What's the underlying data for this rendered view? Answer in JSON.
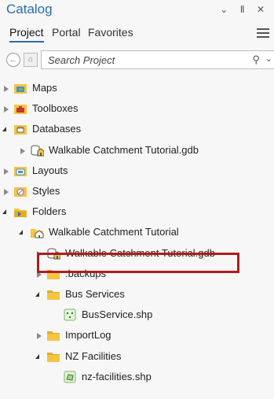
{
  "window": {
    "title": "Catalog",
    "controls": "⌄ ⊥ ✕"
  },
  "tabs": [
    "Project",
    "Portal",
    "Favorites"
  ],
  "search": {
    "placeholder": "Search Project"
  },
  "tree": [
    {
      "label": "Maps",
      "level": 0,
      "state": "closed",
      "icon": "maps-icon"
    },
    {
      "label": "Toolboxes",
      "level": 0,
      "state": "closed",
      "icon": "toolbox-icon"
    },
    {
      "label": "Databases",
      "level": 0,
      "state": "open",
      "icon": "database-folder-icon"
    },
    {
      "label": "Walkable Catchment Tutorial.gdb",
      "level": 1,
      "state": "closed",
      "icon": "geodatabase-icon"
    },
    {
      "label": "Layouts",
      "level": 0,
      "state": "closed",
      "icon": "layouts-icon"
    },
    {
      "label": "Styles",
      "level": 0,
      "state": "closed",
      "icon": "styles-icon"
    },
    {
      "label": "Folders",
      "level": 0,
      "state": "open",
      "icon": "folders-icon"
    },
    {
      "label": "Walkable Catchment Tutorial",
      "level": 1,
      "state": "open",
      "icon": "home-folder-icon"
    },
    {
      "label": "Walkable Catchment Tutorial.gdb",
      "level": 2,
      "state": "closed",
      "icon": "geodatabase-home-icon",
      "highlighted": true
    },
    {
      "label": ".backups",
      "level": 2,
      "state": "closed",
      "icon": "folder-icon"
    },
    {
      "label": "Bus Services",
      "level": 2,
      "state": "open",
      "icon": "folder-icon"
    },
    {
      "label": "BusService.shp",
      "level": 3,
      "state": "none",
      "icon": "point-shapefile-icon"
    },
    {
      "label": "ImportLog",
      "level": 2,
      "state": "closed",
      "icon": "folder-icon"
    },
    {
      "label": "NZ Facilities",
      "level": 2,
      "state": "open",
      "icon": "folder-icon"
    },
    {
      "label": "nz-facilities.shp",
      "level": 3,
      "state": "none",
      "icon": "polygon-shapefile-icon"
    }
  ],
  "colors": {
    "accent": "#2b6cb0",
    "highlight": "#b01c1c",
    "folder": "#f4c542"
  }
}
